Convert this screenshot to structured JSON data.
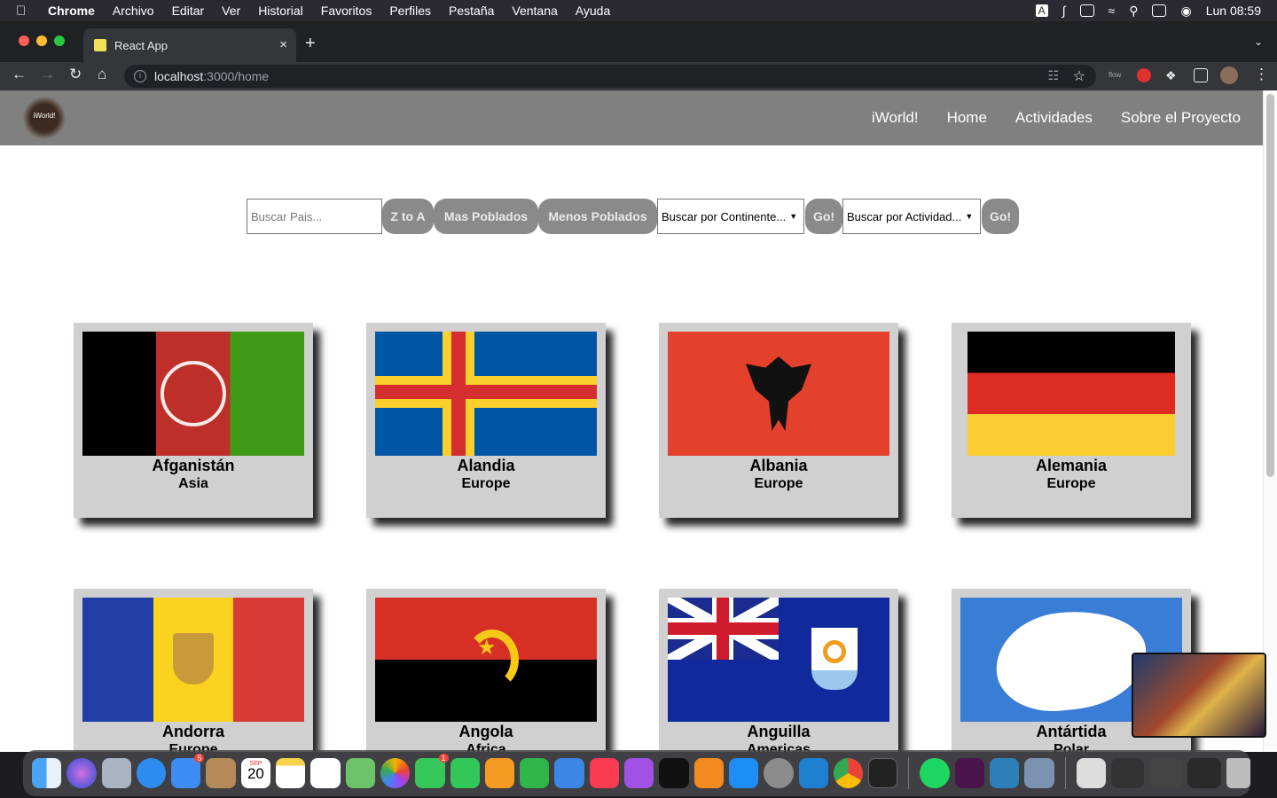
{
  "menubar": {
    "app": "Chrome",
    "items": [
      "Archivo",
      "Editar",
      "Ver",
      "Historial",
      "Favoritos",
      "Perfiles",
      "Pestaña",
      "Ventana",
      "Ayuda"
    ],
    "clock": "Lun 08:59"
  },
  "browser": {
    "tab_title": "React App",
    "url_host": "localhost",
    "url_path": ":3000/home",
    "ext_label": "flow"
  },
  "site": {
    "logo_text": "iWorld!",
    "nav": [
      "iWorld!",
      "Home",
      "Actividades",
      "Sobre el Proyecto"
    ],
    "search_placeholder": "Buscar Pais...",
    "buttons": {
      "sort_az": "Z to A",
      "most_pop": "Mas Poblados",
      "least_pop": "Menos Poblados",
      "go1": "Go!",
      "go2": "Go!"
    },
    "continent_select": "Buscar por Continente...",
    "activity_select": "Buscar por Actividad..."
  },
  "countries": [
    {
      "name": "Afganistán",
      "continent": "Asia"
    },
    {
      "name": "Alandia",
      "continent": "Europe"
    },
    {
      "name": "Albania",
      "continent": "Europe"
    },
    {
      "name": "Alemania",
      "continent": "Europe"
    },
    {
      "name": "Andorra",
      "continent": "Europe"
    },
    {
      "name": "Angola",
      "continent": "Africa"
    },
    {
      "name": "Anguilla",
      "continent": "Americas"
    },
    {
      "name": "Antártida",
      "continent": "Polar"
    }
  ],
  "dock": {
    "mail_badge": "5",
    "messages_badge": "1",
    "calendar_month": "SEP",
    "calendar_day": "20"
  }
}
